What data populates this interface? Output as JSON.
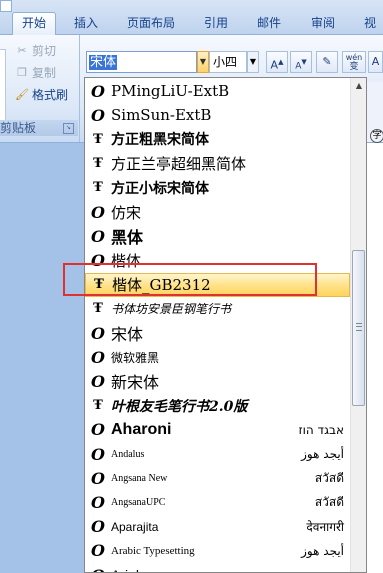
{
  "tabs": [
    "开始",
    "插入",
    "页面布局",
    "引用",
    "邮件",
    "审阅",
    "视"
  ],
  "active_tab": "开始",
  "clipboard": {
    "items": [
      {
        "label": "剪切",
        "icon": "scissors-icon",
        "enabled": false
      },
      {
        "label": "复制",
        "icon": "copy-icon",
        "enabled": false
      },
      {
        "label": "格式刷",
        "icon": "format-painter-icon",
        "enabled": true
      }
    ],
    "group_label": "剪贴板"
  },
  "font_toolbar": {
    "font_name_value": "宋体",
    "font_size_value": "小四",
    "grow_font_label": "A",
    "shrink_font_label": "A",
    "clear_format_label": "",
    "phonetic_label": "wén"
  },
  "font_list": [
    {
      "name": "PMingLiU-ExtB",
      "icon": "opentype-icon",
      "sample": ""
    },
    {
      "name": "SimSun-ExtB",
      "icon": "opentype-icon",
      "sample": ""
    },
    {
      "name": "方正粗黑宋简体",
      "icon": "truetype-icon",
      "sample": ""
    },
    {
      "name": "方正兰亭超细黑简体",
      "icon": "truetype-icon",
      "sample": ""
    },
    {
      "name": "方正小标宋简体",
      "icon": "truetype-icon",
      "sample": ""
    },
    {
      "name": "仿宋",
      "icon": "opentype-icon",
      "sample": ""
    },
    {
      "name": "黑体",
      "icon": "opentype-icon",
      "sample": ""
    },
    {
      "name": "楷体",
      "icon": "opentype-icon",
      "sample": ""
    },
    {
      "name": "楷体_GB2312",
      "icon": "truetype-icon",
      "sample": ""
    },
    {
      "name": "书体坊安景臣钢笔行书",
      "icon": "truetype-icon",
      "sample": ""
    },
    {
      "name": "宋体",
      "icon": "opentype-icon",
      "sample": ""
    },
    {
      "name": "微软雅黑",
      "icon": "opentype-icon",
      "sample": ""
    },
    {
      "name": "新宋体",
      "icon": "opentype-icon",
      "sample": ""
    },
    {
      "name": "叶根友毛笔行书2.0版",
      "icon": "truetype-icon",
      "sample": ""
    },
    {
      "name": "Aharoni",
      "icon": "opentype-icon",
      "sample": "אבגד הוז"
    },
    {
      "name": "Andalus",
      "icon": "opentype-icon",
      "sample": "أيجد هوز"
    },
    {
      "name": "Angsana New",
      "icon": "opentype-icon",
      "sample": "สวัสดี"
    },
    {
      "name": "AngsanaUPC",
      "icon": "opentype-icon",
      "sample": "สวัสดี"
    },
    {
      "name": "Aparajita",
      "icon": "opentype-icon",
      "sample": "देवनागरी"
    },
    {
      "name": "Arabic Typesetting",
      "icon": "opentype-icon",
      "sample": "أيجد هوز"
    },
    {
      "name": "Arial",
      "icon": "opentype-icon",
      "sample": ""
    }
  ],
  "hovered_font_index": 8,
  "colors": {
    "ribbon_text": "#15428b",
    "hover_highlight": "#ffe28a",
    "annotation_box": "#e03030"
  }
}
